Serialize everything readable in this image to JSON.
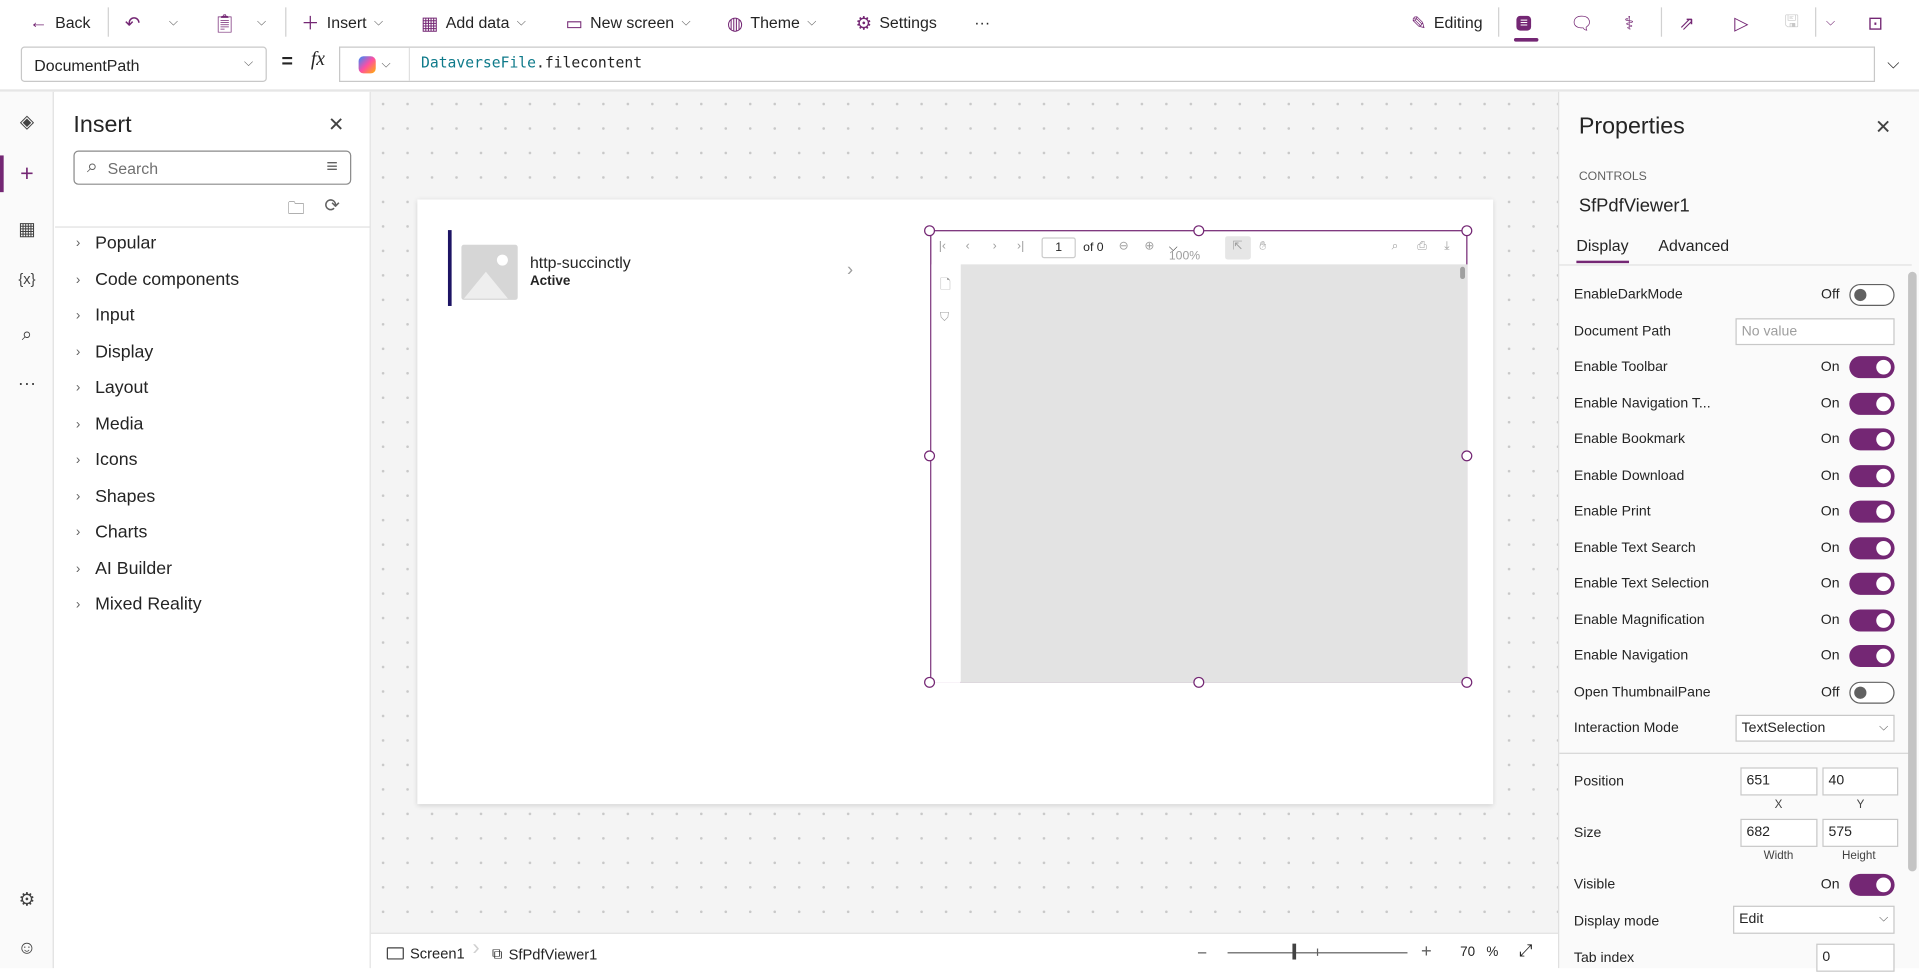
{
  "toolbar": {
    "back": "Back",
    "insert": "Insert",
    "add_data": "Add data",
    "new_screen": "New screen",
    "theme": "Theme",
    "settings": "Settings",
    "more": "···",
    "editing": "Editing"
  },
  "formula": {
    "property": "DocumentPath",
    "equals": "=",
    "fx": "fx",
    "object": "DataverseFile",
    "member": ".filecontent"
  },
  "insert_panel": {
    "title": "Insert",
    "search_placeholder": "Search",
    "items": [
      "Popular",
      "Code components",
      "Input",
      "Display",
      "Layout",
      "Media",
      "Icons",
      "Shapes",
      "Charts",
      "AI Builder",
      "Mixed Reality"
    ]
  },
  "canvas": {
    "gallery": {
      "title": "http-succinctly",
      "subtitle": "Active"
    },
    "pdf": {
      "page": "1",
      "of": "of 0",
      "zoom": "100%"
    }
  },
  "bottom": {
    "screen": "Screen1",
    "control": "SfPdfViewer1",
    "zoom_value": "70",
    "zoom_unit": "%",
    "zoom_level": 70
  },
  "properties": {
    "title": "Properties",
    "section": "CONTROLS",
    "control_name": "SfPdfViewer1",
    "tabs": [
      "Display",
      "Advanced"
    ],
    "rows": [
      {
        "label": "EnableDarkMode",
        "state": "Off"
      },
      {
        "label": "Document Path",
        "placeholder": "No value"
      },
      {
        "label": "Enable Toolbar",
        "state": "On"
      },
      {
        "label": "Enable Navigation T...",
        "state": "On"
      },
      {
        "label": "Enable Bookmark",
        "state": "On"
      },
      {
        "label": "Enable Download",
        "state": "On"
      },
      {
        "label": "Enable Print",
        "state": "On"
      },
      {
        "label": "Enable Text Search",
        "state": "On"
      },
      {
        "label": "Enable Text Selection",
        "state": "On"
      },
      {
        "label": "Enable Magnification",
        "state": "On"
      },
      {
        "label": "Enable Navigation",
        "state": "On"
      },
      {
        "label": "Open ThumbnailPane",
        "state": "Off"
      },
      {
        "label": "Interaction Mode",
        "value": "TextSelection"
      }
    ],
    "position": {
      "label": "Position",
      "x": "651",
      "y": "40",
      "x_label": "X",
      "y_label": "Y"
    },
    "size": {
      "label": "Size",
      "width": "682",
      "height": "575",
      "w_label": "Width",
      "h_label": "Height"
    },
    "visible": {
      "label": "Visible",
      "state": "On"
    },
    "display_mode": {
      "label": "Display mode",
      "value": "Edit"
    },
    "tab_index": {
      "label": "Tab index",
      "value": "0"
    }
  },
  "colors": {
    "accent": "#742774"
  }
}
